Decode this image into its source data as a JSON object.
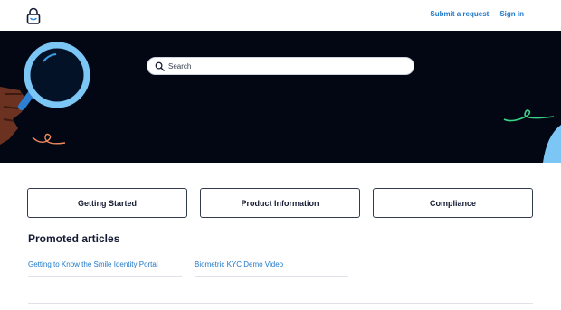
{
  "header": {
    "logo_icon": "padlock-smile-icon",
    "nav": {
      "submit_request": "Submit a request",
      "sign_in": "Sign in"
    }
  },
  "hero": {
    "background_color": "#020713",
    "search": {
      "placeholder": "Search",
      "value": "",
      "icon": "search-icon"
    }
  },
  "categories": [
    {
      "label": "Getting Started"
    },
    {
      "label": "Product Information"
    },
    {
      "label": "Compliance"
    }
  ],
  "promoted": {
    "title": "Promoted articles",
    "articles": [
      {
        "label": "Getting to Know the Smile Identity Portal"
      },
      {
        "label": "Biometric KYC Demo Video"
      }
    ]
  },
  "colors": {
    "link": "#1e78c8",
    "text": "#151a33",
    "accent_light_blue": "#7cc6f5",
    "accent_green": "#3ad58a",
    "accent_orange": "#f08a5d"
  }
}
